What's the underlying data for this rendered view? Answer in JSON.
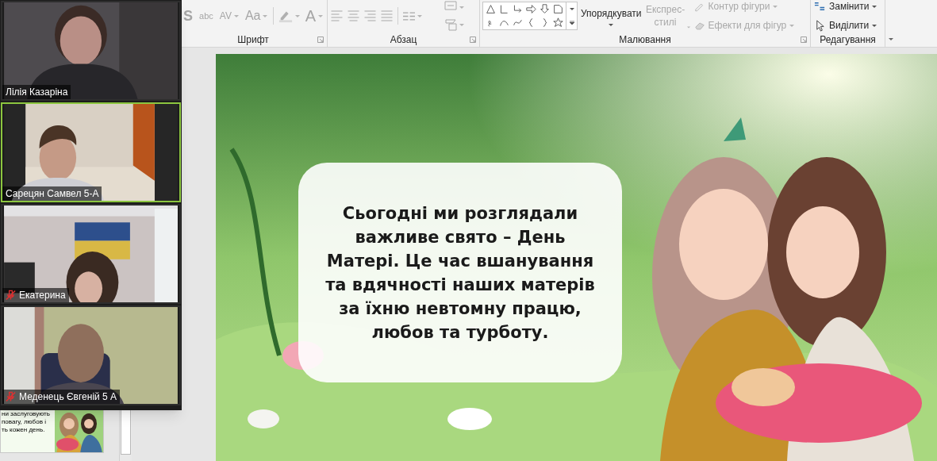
{
  "ribbon": {
    "font_group": {
      "label": "Шрифт",
      "buttons": [
        "S",
        "abc",
        "AV",
        "Aa",
        "A"
      ]
    },
    "paragraph_group": {
      "label": "Абзац"
    },
    "drawing_group": {
      "label": "Малювання",
      "commands": [
        {
          "label": "Упорядкувати",
          "disabled": false
        },
        {
          "label": "Експрес-стилі",
          "disabled": true
        },
        {
          "label": "Контур фігури",
          "disabled": true
        },
        {
          "label": "Ефекти для фігур",
          "disabled": true
        }
      ]
    },
    "editing_group": {
      "label": "Редагування",
      "commands": [
        {
          "label": "Замінити",
          "disabled": false
        },
        {
          "label": "Виділити",
          "disabled": false
        }
      ]
    }
  },
  "participants": [
    {
      "name": "Лілія Казаріна",
      "muted": false,
      "active": false
    },
    {
      "name": "Сарецян Самвел 5-А",
      "muted": false,
      "active": true
    },
    {
      "name": "Екатерина",
      "muted": true,
      "active": false
    },
    {
      "name": "Меденець Євгеній 5 А",
      "muted": true,
      "active": false
    }
  ],
  "thumbnail": {
    "text_lines": [
      "ни заслуговують",
      "повагу, любов і",
      "ть кожен день."
    ]
  },
  "slide": {
    "text": "Сьогодні ми розглядали важливе свято – День Матері. Це час вшанування та вдячності наших матерів за їхню невтомну працю, любов та турботу."
  }
}
